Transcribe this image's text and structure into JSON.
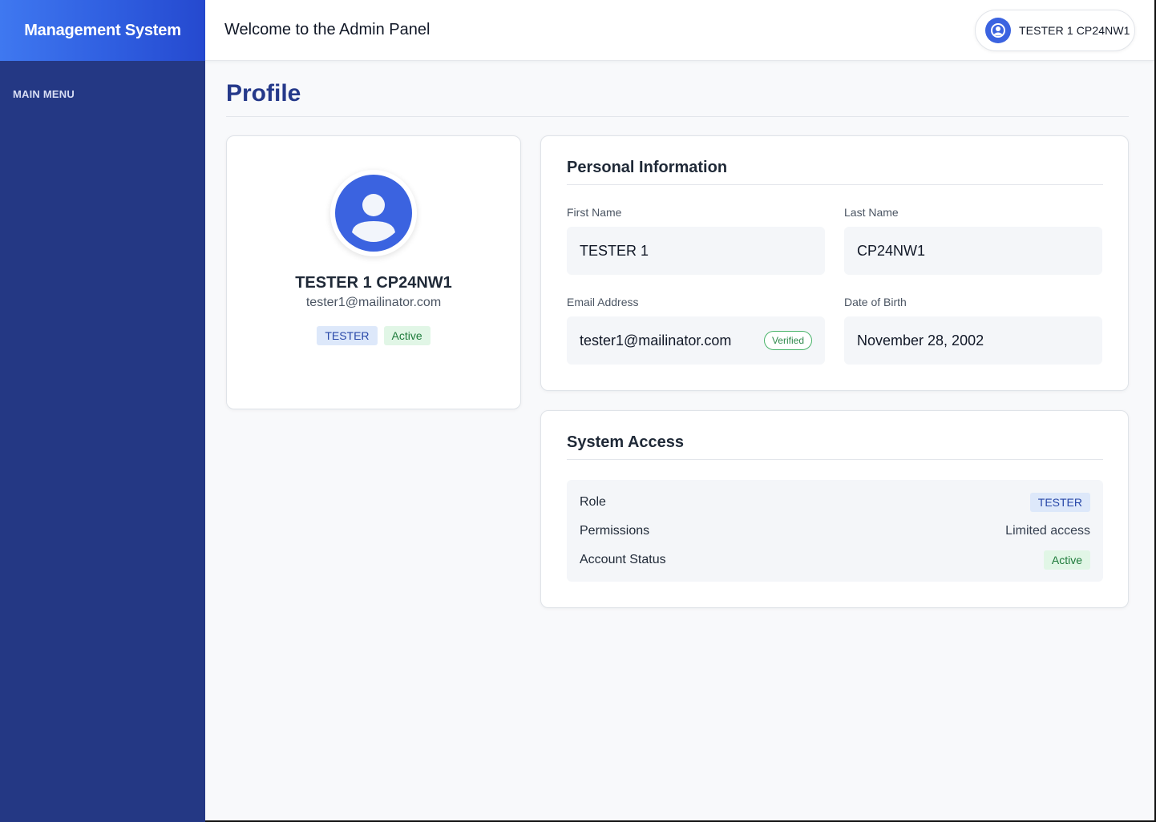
{
  "sidebar": {
    "brand": "Management System",
    "menu_label": "MAIN MENU"
  },
  "header": {
    "welcome": "Welcome to the Admin Panel",
    "user_name": "TESTER 1 CP24NW1"
  },
  "page": {
    "title": "Profile"
  },
  "profile_card": {
    "name": "TESTER 1 CP24NW1",
    "email": "tester1@mailinator.com",
    "role_badge": "TESTER",
    "status_badge": "Active"
  },
  "personal_info": {
    "title": "Personal Information",
    "first_name_label": "First Name",
    "first_name": "TESTER 1",
    "last_name_label": "Last Name",
    "last_name": "CP24NW1",
    "email_label": "Email Address",
    "email": "tester1@mailinator.com",
    "email_verified": "Verified",
    "dob_label": "Date of Birth",
    "dob": "November 28, 2002"
  },
  "system_access": {
    "title": "System Access",
    "role_label": "Role",
    "role": "TESTER",
    "permissions_label": "Permissions",
    "permissions": "Limited access",
    "status_label": "Account Status",
    "status": "Active"
  },
  "colors": {
    "sidebar": "#243884",
    "accent": "#3b63e0",
    "title": "#25398a",
    "active_green": "#1d7a3a"
  }
}
